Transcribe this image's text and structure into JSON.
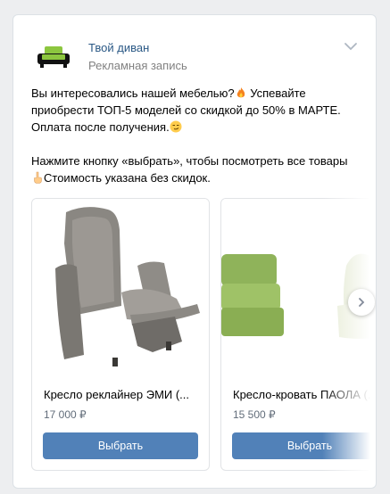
{
  "post": {
    "brand": "Твой диван",
    "subtitle": "Рекламная запись",
    "icons": {
      "avatar": "sofa-logo",
      "more": "chevron-down-icon"
    },
    "text": {
      "line1": "Вы интересовались нашей мебелью?",
      "line1b": " Успевайте приобрести ТОП-5 моделей со скидкой до 50% в МАРТЕ. Оплата после получения.",
      "line2": "Нажмите кнопку «выбрать», чтобы посмотреть все товары ",
      "line2b": "Стоимость указана без скидок."
    }
  },
  "carousel": {
    "cards": [
      {
        "title": "Кресло реклайнер ЭМИ (...",
        "price": "17 000 ₽",
        "button": "Выбрать"
      },
      {
        "title": "Кресло-кровать ПАОЛА (...",
        "price": "15 500 ₽",
        "button": "Выбрать"
      }
    ]
  },
  "colors": {
    "accent": "#5181b8",
    "link": "#2a5885"
  }
}
